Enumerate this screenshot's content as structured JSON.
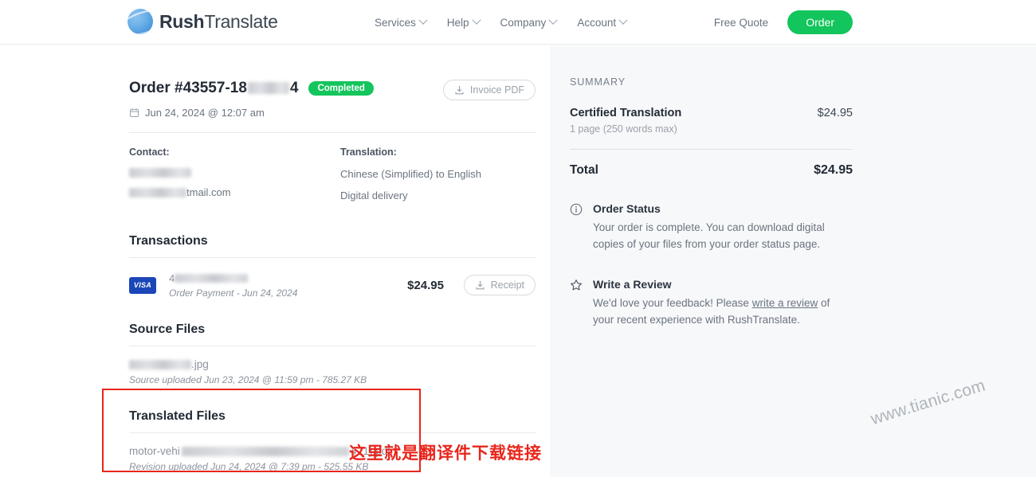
{
  "header": {
    "logo_bold": "Rush",
    "logo_light": "Translate",
    "nav": [
      {
        "label": "Services"
      },
      {
        "label": "Help"
      },
      {
        "label": "Company"
      },
      {
        "label": "Account"
      }
    ],
    "free_quote": "Free Quote",
    "order_button": "Order"
  },
  "order": {
    "title_prefix": "Order #43557-18",
    "title_suffix": "4",
    "status_badge": "Completed",
    "invoice_button": "Invoice PDF",
    "date": "Jun 24, 2024 @ 12:07 am",
    "contact_label": "Contact:",
    "contact_email_suffix": "tmail.com",
    "translation_label": "Translation:",
    "translation_pair": "Chinese (Simplified) to English",
    "delivery": "Digital delivery"
  },
  "transactions": {
    "title": "Transactions",
    "card_brand": "VISA",
    "card_number_prefix": "4",
    "description": "Order Payment - Jun 24, 2024",
    "amount": "$24.95",
    "receipt_button": "Receipt"
  },
  "source_files": {
    "title": "Source Files",
    "file_extension": ".jpg",
    "meta": "Source uploaded Jun 23, 2024 @ 11:59 pm - 785.27 KB"
  },
  "translated_files": {
    "title": "Translated Files",
    "file_name_prefix": "motor-vehi",
    "file_name_suffix": "4 (1).pdf",
    "meta": "Revision uploaded Jun 24, 2024 @ 7:39 pm - 525.55 KB"
  },
  "annotation": {
    "text": "这里就是翻译件下载链接",
    "color": "#e8251b"
  },
  "summary": {
    "heading": "SUMMARY",
    "item_name": "Certified Translation",
    "item_price": "$24.95",
    "item_detail": "1 page (250 words max)",
    "total_label": "Total",
    "total_price": "$24.95"
  },
  "order_status": {
    "title": "Order Status",
    "body": "Your order is complete. You can download digital copies of your files from your order status page."
  },
  "review": {
    "title": "Write a Review",
    "body_before": "We'd love your feedback! Please ",
    "link": "write a review",
    "body_after": " of your recent experience with RushTranslate."
  },
  "watermark": {
    "text": "www.tianic.com"
  },
  "colors": {
    "accent_green": "#12c55c",
    "visa_blue": "#1a46b8",
    "annotation_red": "#e8251b",
    "panel_bg": "#f7f8f9"
  }
}
